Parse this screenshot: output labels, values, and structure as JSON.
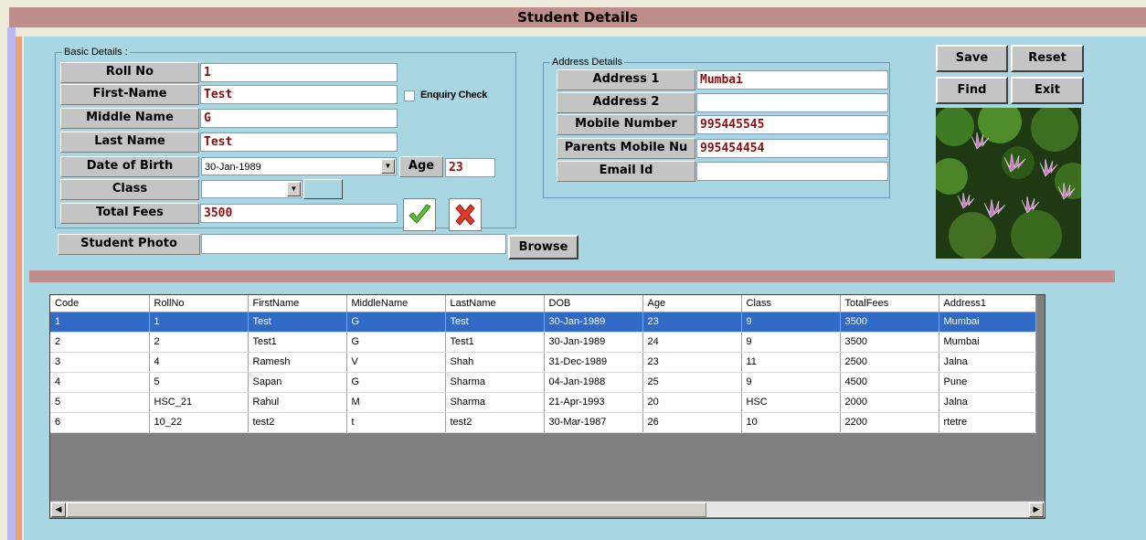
{
  "window": {
    "title": "Student Details"
  },
  "basic": {
    "group_label": "Basic Details :",
    "roll_no": {
      "label": "Roll No",
      "value": "1"
    },
    "first_name": {
      "label": "First-Name",
      "value": "Test"
    },
    "middle_name": {
      "label": "Middle Name",
      "value": "G"
    },
    "last_name": {
      "label": "Last Name",
      "value": "Test"
    },
    "dob": {
      "label": "Date of Birth",
      "value": "30-Jan-1989"
    },
    "age": {
      "label": "Age",
      "value": "23"
    },
    "class": {
      "label": "Class",
      "value": ""
    },
    "total_fees": {
      "label": "Total Fees",
      "value": "3500"
    },
    "enquiry_check": {
      "label": "Enquiry Check",
      "checked": false
    },
    "student_photo": {
      "label": "Student Photo",
      "value": "",
      "browse_label": "Browse"
    }
  },
  "address": {
    "group_label": "Address Details",
    "address1": {
      "label": "Address 1",
      "value": "Mumbai"
    },
    "address2": {
      "label": "Address 2",
      "value": ""
    },
    "mobile": {
      "label": "Mobile Number",
      "value": "995445545"
    },
    "parents_mobile": {
      "label": "Parents Mobile Nu",
      "value": "995454454"
    },
    "email": {
      "label": "Email Id",
      "value": ""
    }
  },
  "buttons": {
    "save": "Save",
    "reset": "Reset",
    "find": "Find",
    "exit": "Exit"
  },
  "icons": {
    "confirm": "green-checkmark-icon",
    "cancel": "red-x-icon",
    "photo": "water-lily-photo"
  },
  "grid": {
    "columns": [
      "Code",
      "RollNo",
      "FirstName",
      "MiddleName",
      "LastName",
      "DOB",
      "Age",
      "Class",
      "TotalFees",
      "Address1"
    ],
    "rows": [
      [
        "1",
        "1",
        "Test",
        "G",
        "Test",
        "30-Jan-1989",
        "23",
        "9",
        "3500",
        "Mumbai"
      ],
      [
        "2",
        "2",
        "Test1",
        "G",
        "Test1",
        "30-Jan-1989",
        "24",
        "9",
        "3500",
        "Mumbai"
      ],
      [
        "3",
        "4",
        "Ramesh",
        "V",
        "Shah",
        "31-Dec-1989",
        "23",
        "11",
        "2500",
        "Jalna"
      ],
      [
        "4",
        "5",
        "Sapan",
        "G",
        "Sharma",
        "04-Jan-1988",
        "25",
        "9",
        "4500",
        "Pune"
      ],
      [
        "5",
        "HSC_21",
        "Rahul",
        "M",
        "Sharma",
        "21-Apr-1993",
        "20",
        "HSC",
        "2000",
        "Jalna"
      ],
      [
        "6",
        "10_22",
        "test2",
        "t",
        "test2",
        "30-Mar-1987",
        "26",
        "10",
        "2200",
        "rtetre"
      ]
    ],
    "selected_row": 0
  },
  "colors": {
    "title_bar": "#bf8e8b",
    "panel": "#a9d6e3",
    "value_text": "#8b0d0d",
    "selection": "#316ac5"
  }
}
